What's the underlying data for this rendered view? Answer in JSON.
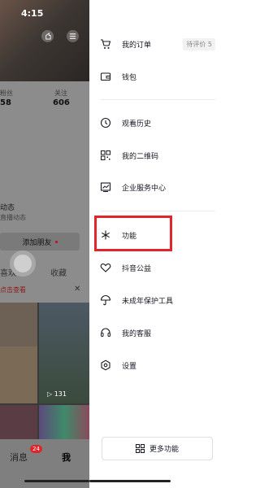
{
  "status": {
    "time": "4:15"
  },
  "profile": {
    "fans_label": "粉丝",
    "fans_value": "58",
    "following_label": "关注",
    "following_value": "606",
    "section_title": "动态",
    "section_sub": "直播动态",
    "add_friend_label": "添加朋友",
    "likes_tab": "喜欢",
    "collect_tab": "收藏",
    "view_link": "点击查看",
    "video_plays": "131"
  },
  "tabbar": {
    "messages": "消息",
    "messages_badge": "24",
    "me": "我"
  },
  "drawer": {
    "items": [
      {
        "label": "我的订单",
        "icon": "cart-icon",
        "badge": "待评价 5"
      },
      {
        "label": "钱包",
        "icon": "wallet-icon"
      },
      {
        "label": "观看历史",
        "icon": "clock-icon"
      },
      {
        "label": "我的二维码",
        "icon": "qrcode-icon"
      },
      {
        "label": "企业服务中心",
        "icon": "chart-icon"
      },
      {
        "label": "功能",
        "icon": "spark-icon"
      },
      {
        "label": "抖音公益",
        "icon": "heart-icon"
      },
      {
        "label": "未成年保护工具",
        "icon": "umbrella-icon"
      },
      {
        "label": "我的客服",
        "icon": "headset-icon"
      },
      {
        "label": "设置",
        "icon": "settings-icon"
      }
    ],
    "more_button": "更多功能"
  },
  "colors": {
    "accent": "#e3242b",
    "text": "#161823",
    "badge": "#e0242b"
  }
}
